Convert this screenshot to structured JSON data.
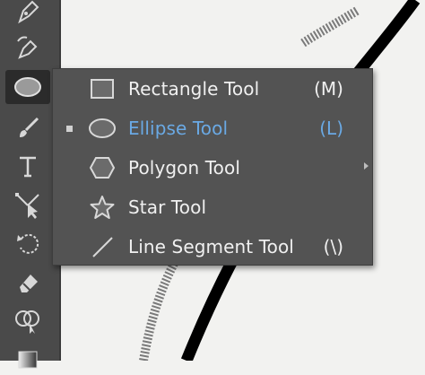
{
  "toolbar": {
    "tools": [
      {
        "name": "pen-tool",
        "active": false
      },
      {
        "name": "curvature-tool",
        "active": false
      },
      {
        "name": "ellipse-tool",
        "active": true
      },
      {
        "name": "paintbrush-tool",
        "active": false
      },
      {
        "name": "type-tool",
        "active": false
      },
      {
        "name": "direct-selection-tool",
        "active": false
      },
      {
        "name": "rotate-tool",
        "active": false
      },
      {
        "name": "eraser-tool",
        "active": false
      },
      {
        "name": "shape-builder-tool",
        "active": false
      },
      {
        "name": "gradient-tool",
        "active": false
      }
    ]
  },
  "flyout": {
    "items": [
      {
        "label": "Rectangle Tool",
        "shortcut": "(M)",
        "icon": "rectangle-icon",
        "selected": false
      },
      {
        "label": "Ellipse Tool",
        "shortcut": "(L)",
        "icon": "ellipse-icon",
        "selected": true
      },
      {
        "label": "Polygon Tool",
        "shortcut": "",
        "icon": "polygon-icon",
        "selected": false
      },
      {
        "label": "Star Tool",
        "shortcut": "",
        "icon": "star-icon",
        "selected": false
      },
      {
        "label": "Line Segment Tool",
        "shortcut": "(\\)",
        "icon": "line-segment-icon",
        "selected": false
      }
    ]
  },
  "colors": {
    "panel": "#535353",
    "toolbar": "#4a4a4a",
    "selected_text": "#6aa9e4",
    "text": "#f0f0f0",
    "canvas": "#f2f2f0"
  }
}
